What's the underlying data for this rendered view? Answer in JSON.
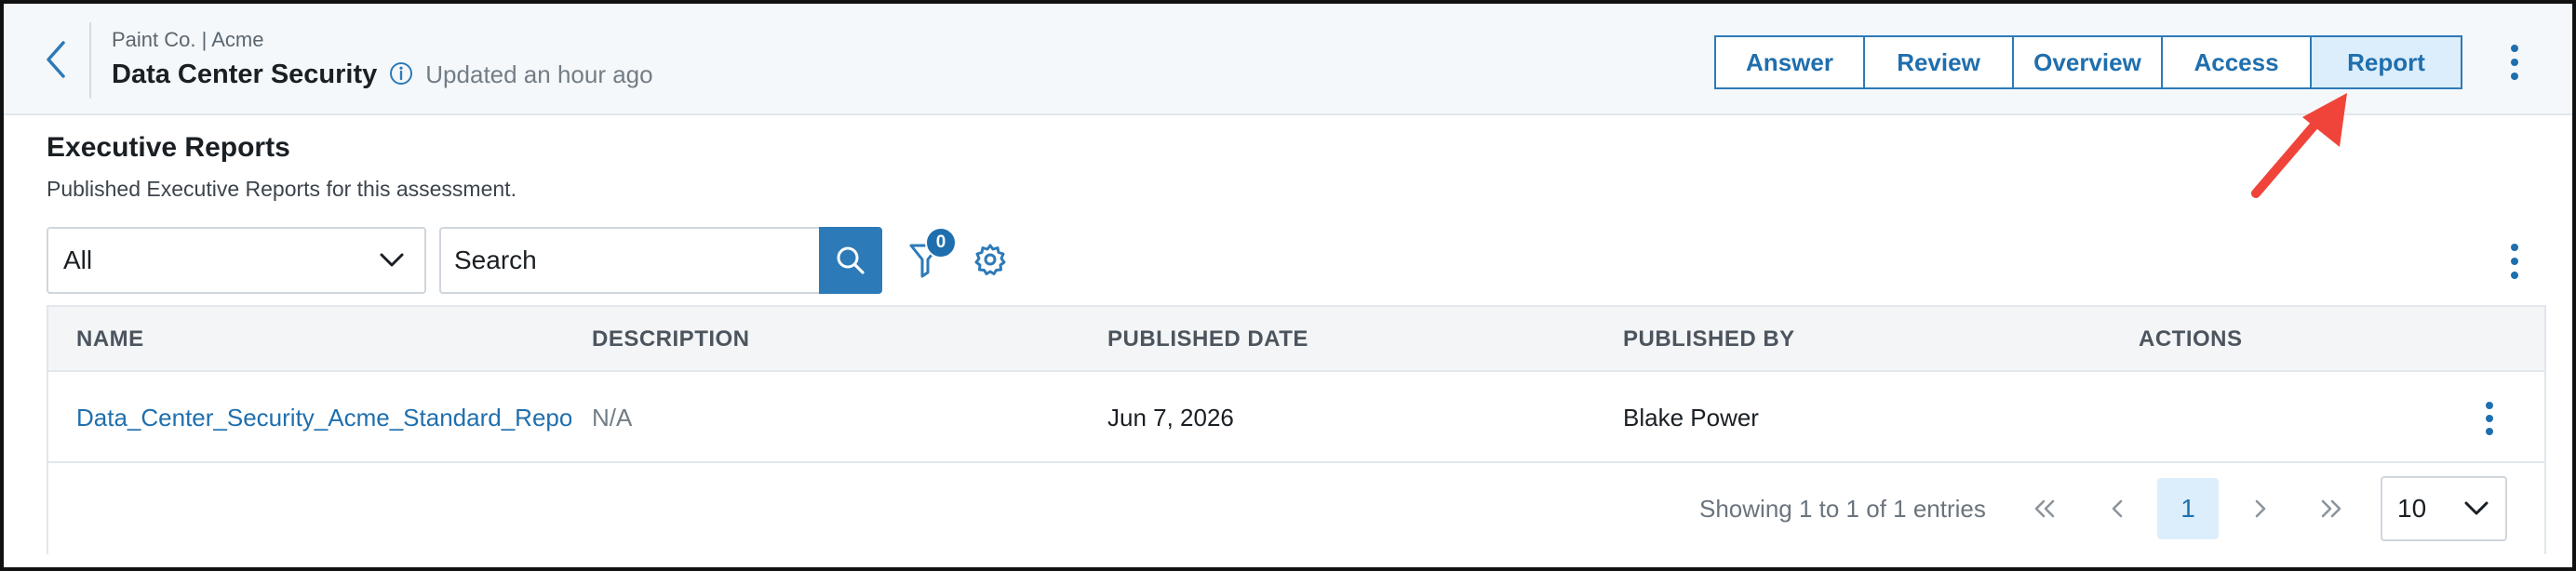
{
  "header": {
    "breadcrumb": "Paint Co. | Acme",
    "title": "Data Center Security",
    "updated": "Updated an hour ago",
    "tabs": [
      {
        "label": "Answer",
        "active": false
      },
      {
        "label": "Review",
        "active": false
      },
      {
        "label": "Overview",
        "active": false
      },
      {
        "label": "Access",
        "active": false
      },
      {
        "label": "Report",
        "active": true
      }
    ],
    "accent_color": "#1f6fae"
  },
  "section": {
    "title": "Executive Reports",
    "subtitle": "Published Executive Reports for this assessment."
  },
  "toolbar": {
    "filter_value": "All",
    "search_value": "Search",
    "filter_count": "0"
  },
  "table": {
    "columns": [
      "NAME",
      "DESCRIPTION",
      "PUBLISHED DATE",
      "PUBLISHED BY",
      "ACTIONS"
    ],
    "rows": [
      {
        "name": "Data_Center_Security_Acme_Standard_Report",
        "description": "N/A",
        "published_date": "Jun 7, 2026",
        "published_by": "Blake Power"
      }
    ]
  },
  "pagination": {
    "showing": "Showing 1 to 1 of 1 entries",
    "first": "«",
    "prev": "‹",
    "current_page": "1",
    "next": "›",
    "last": "»",
    "page_size": "10"
  },
  "annotation": {
    "arrow_color": "#f0443a"
  }
}
